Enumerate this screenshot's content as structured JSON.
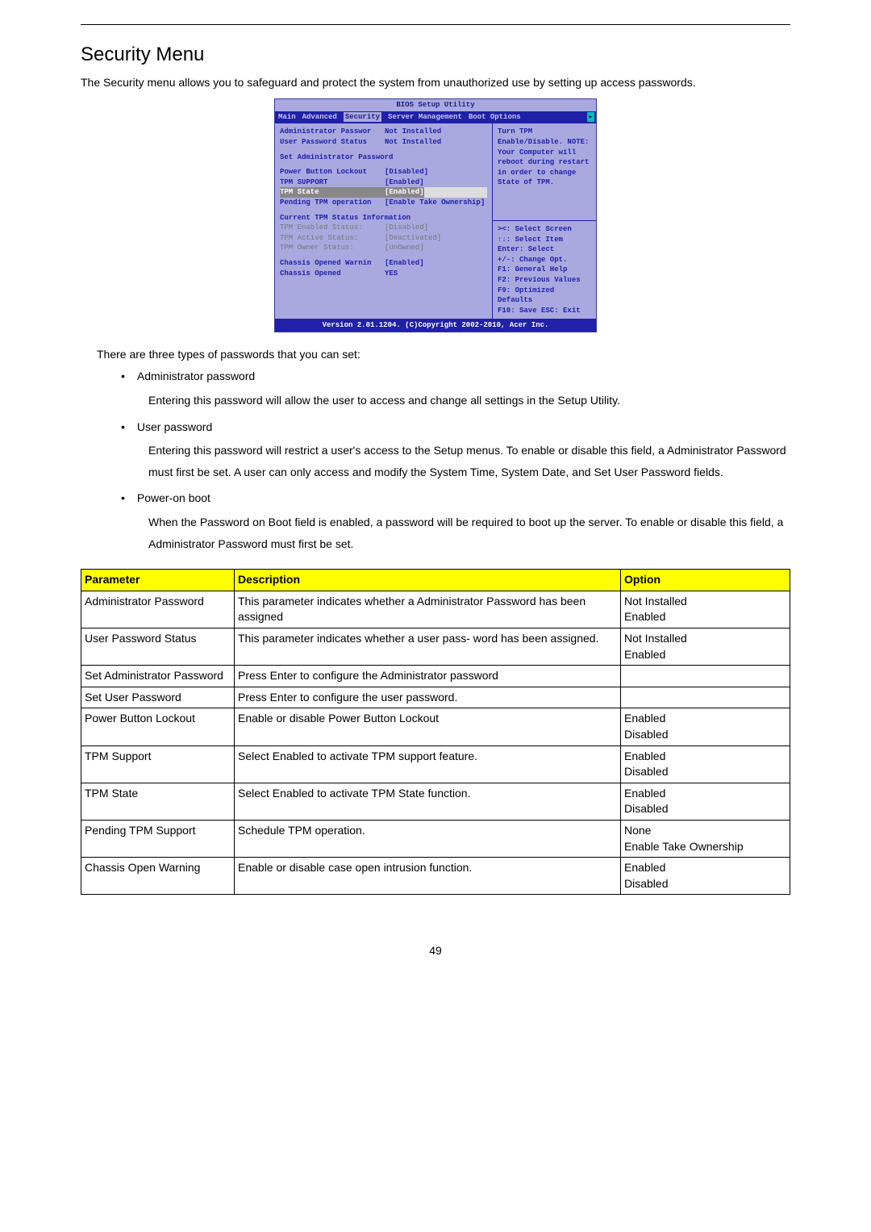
{
  "page_number": "49",
  "section_title": "Security Menu",
  "intro": "The Security menu allows you to safeguard and protect the system from unauthorized use by setting up access passwords.",
  "bios": {
    "title": "BIOS Setup Utility",
    "tabs": [
      "Main",
      "Advanced",
      "Security",
      "Server Management",
      "Boot Options"
    ],
    "active_tab": "Security",
    "arrow": "▸",
    "left": {
      "admin_pw_label": "Administrator Passwor",
      "admin_pw_value": "Not Installed",
      "user_pw_label": "User Password Status",
      "user_pw_value": "Not Installed",
      "set_admin": "Set Administrator Password",
      "power_button_label": "Power Button Lockout",
      "power_button_value": "[Disabled]",
      "tpm_support_label": "TPM SUPPORT",
      "tpm_support_value": "[Enabled]",
      "tpm_state_label": "TPM State",
      "tpm_state_value": "[Enabled]",
      "pending_label": "Pending TPM operation",
      "pending_value": "[Enable Take Ownership]",
      "status_header": "Current TPM Status Information",
      "tpm_enabled_label": "TPM Enabled Status:",
      "tpm_enabled_value": "[Disabled]",
      "tpm_active_label": "TPM Active Status:",
      "tpm_active_value": "[Deactivated]",
      "tpm_owner_label": "TPM Owner Status:",
      "tpm_owner_value": "[UnOwned]",
      "chassis_warn_label": "Chassis Opened Warnin",
      "chassis_warn_value": "[Enabled]",
      "chassis_opened_label": "Chassis Opened",
      "chassis_opened_value": "YES"
    },
    "help_top": [
      "Turn TPM",
      "Enable/Disable. NOTE:",
      "Your Computer will",
      "reboot during restart",
      "in order to change",
      "State of TPM."
    ],
    "help_keys": [
      "><: Select Screen",
      "↑↓: Select Item",
      "Enter: Select",
      "+/-: Change Opt.",
      "F1: General Help",
      "F2: Previous Values",
      "F9: Optimized Defaults",
      "F10: Save  ESC: Exit"
    ],
    "footer": "Version 2.01.1204. (C)Copyright 2002-2010, Acer Inc."
  },
  "types_intro": "There are three types of passwords that you can set:",
  "types": [
    {
      "label": "Administrator password",
      "desc": "Entering this password will allow the user to access and change all settings in the Setup Utility."
    },
    {
      "label": "User password",
      "desc": "Entering this password will restrict a user's access to the Setup menus. To enable or disable this field, a Administrator Password must first be set. A user can only access and modify the System Time, System Date, and Set User Password fields."
    },
    {
      "label": "Power-on boot",
      "desc": "When the Password on Boot field is enabled, a password will be required to boot up the server. To enable or disable this field, a Administrator Password must first be set."
    }
  ],
  "table": {
    "headers": [
      "Parameter",
      "Description",
      "Option"
    ],
    "rows": [
      {
        "param": "Administrator Password",
        "desc": "This parameter indicates whether a Administrator Password has been assigned",
        "opt": "Not Installed\nEnabled"
      },
      {
        "param": "User Password Status",
        "desc": "This parameter indicates whether a user pass- word has been assigned.",
        "opt": "Not Installed\nEnabled"
      },
      {
        "param": "Set Administrator Password",
        "desc": "Press Enter to configure the Administrator password",
        "opt": ""
      },
      {
        "param": "Set User Password",
        "desc": "Press Enter to configure the user password.",
        "opt": ""
      },
      {
        "param": "Power Button Lockout",
        "desc": "Enable or disable Power Button Lockout",
        "opt": "Enabled\nDisabled\n "
      },
      {
        "param": "TPM Support",
        "desc": "Select Enabled to activate TPM support feature.",
        "opt": "Enabled\nDisabled\n "
      },
      {
        "param": "TPM State",
        "desc": "Select Enabled to activate TPM State function.",
        "opt": "Enabled\nDisabled\n "
      },
      {
        "param": "Pending TPM Support",
        "desc": "Schedule TPM operation.",
        "opt": "None\nEnable Take Ownership"
      },
      {
        "param": "Chassis Open Warning",
        "desc": "Enable or disable case open intrusion function.",
        "opt": "Enabled\nDisabled"
      }
    ]
  }
}
